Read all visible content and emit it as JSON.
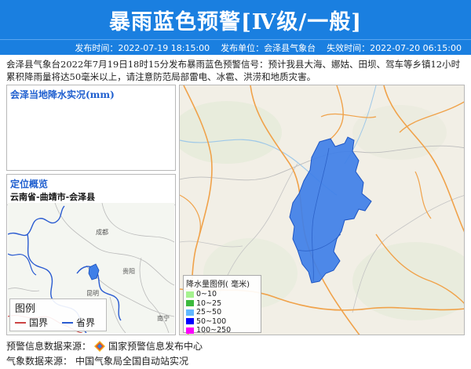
{
  "header": {
    "title": "暴雨蓝色预警[Ⅳ级/一般]",
    "publish_time": "发布时间：2022-07-19 18:15:00",
    "publisher": "发布单位：会泽县气象台",
    "expire_time": "失效时间：2022-07-20 06:15:00"
  },
  "description": "会泽县气象台2022年7月19日18时15分发布暴雨蓝色预警信号：预计我县大海、娜姑、田坝、驾车等乡镇12小时累积降雨量将达50毫米以上，请注意防范局部雷电、冰雹、洪涝和地质灾害。",
  "rain_panel": {
    "title": "会泽当地降水实况(mm)"
  },
  "location_panel": {
    "title": "定位概览",
    "subtitle": "云南省-曲靖市-会泽县",
    "cities": [
      "成都",
      "贵阳",
      "昆明",
      "南宁"
    ],
    "legend": {
      "title": "图例",
      "country": "国界",
      "province": "省界"
    }
  },
  "rain_legend": {
    "title": "降水量图例( 毫米)",
    "items": [
      {
        "label": "0~10",
        "color": "#a6f28f"
      },
      {
        "label": "10~25",
        "color": "#3dba3d"
      },
      {
        "label": "25~50",
        "color": "#61b8ff"
      },
      {
        "label": "50~100",
        "color": "#0000ff"
      },
      {
        "label": "100~250",
        "color": "#fa00fa"
      }
    ]
  },
  "colors": {
    "banner": "#1a7fe0",
    "warning_area": "#3f7fe8",
    "panel_title": "#1f5fcf"
  },
  "footer": {
    "source_label": "预警信息数据来源：",
    "source_value": "国家预警信息发布中心",
    "weather_label": "气象数据来源：",
    "weather_value": "中国气象局全国自动站实况"
  }
}
